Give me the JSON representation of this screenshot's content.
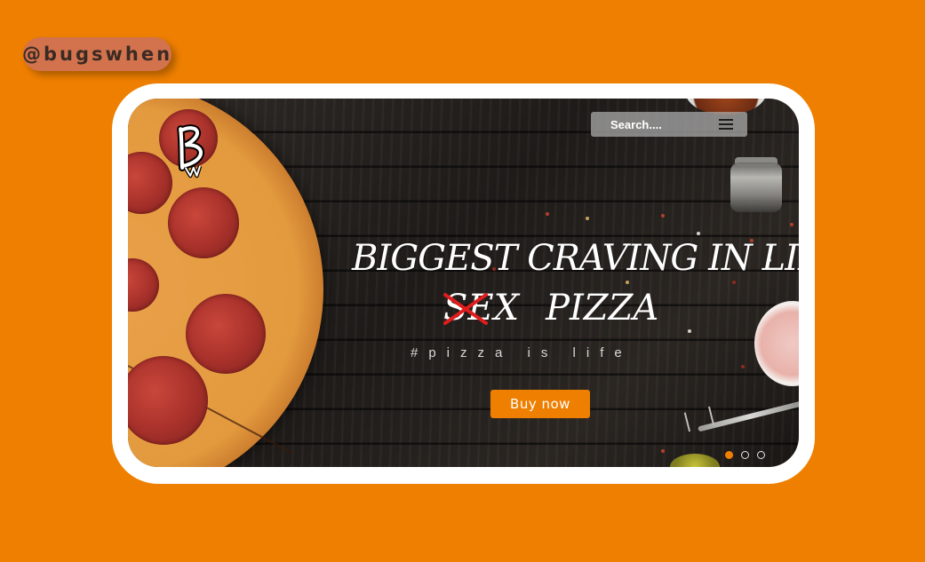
{
  "watermark": {
    "handle": "@bugswhen"
  },
  "header": {
    "logo_letter": "B",
    "search": {
      "placeholder": "Search...."
    }
  },
  "hero": {
    "headline": "BIGGEST CRAVING IN LIFE.",
    "struck_word": "SEX",
    "replacement_word": "PIZZA",
    "tagline": "#pizza is life",
    "cta_label": "Buy now"
  },
  "carousel": {
    "slides": 3,
    "active_index": 0
  },
  "colors": {
    "brand_orange": "#ee7f00",
    "frame_white": "#ffffff",
    "strike_red": "#e01d1d"
  },
  "icons": [
    "menu-icon",
    "brand-logo-icon"
  ]
}
